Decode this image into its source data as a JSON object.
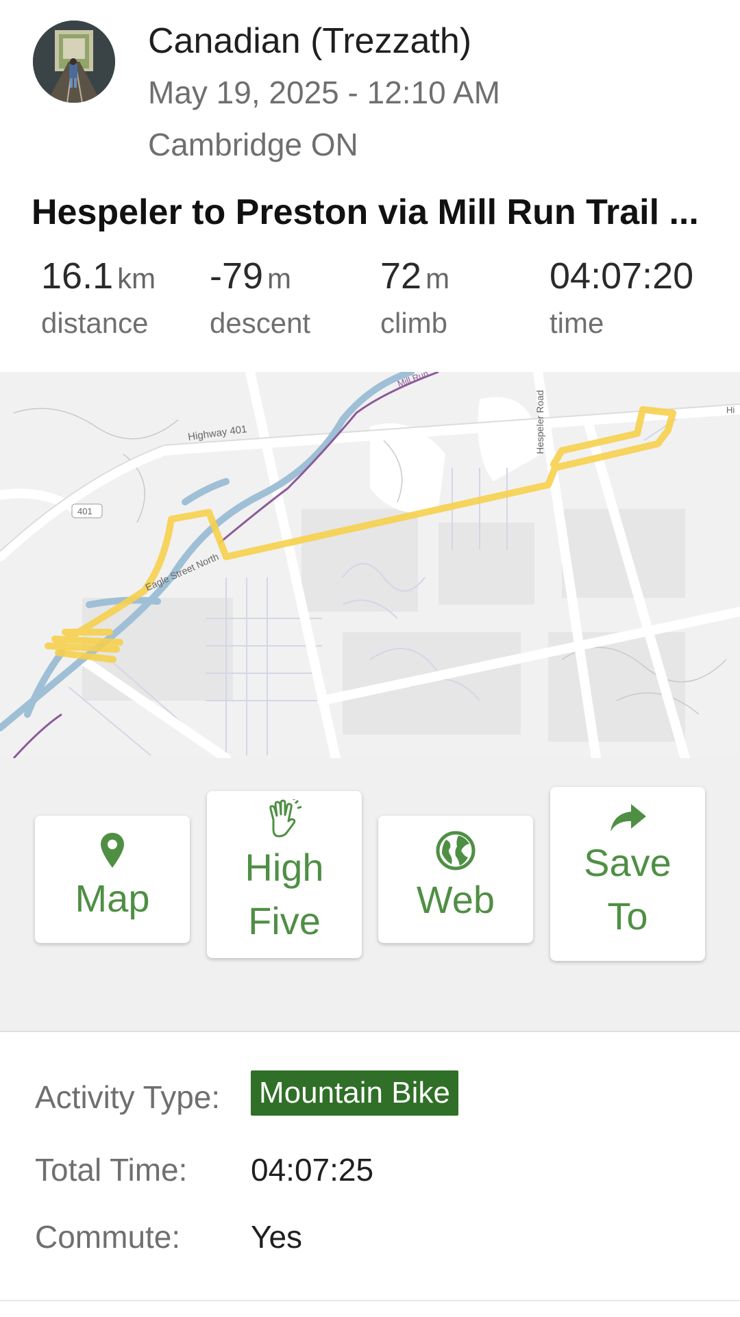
{
  "header": {
    "user_name": "Canadian (Trezzath)",
    "date": "May 19, 2025 - 12:10 AM",
    "location": "Cambridge ON",
    "avatar_icon": "user-photo-railway-tunnel"
  },
  "activity": {
    "title": "Hespeler to Preston via Mill Run Trail ..."
  },
  "stats": [
    {
      "value": "16.1",
      "unit": "km",
      "label": "distance"
    },
    {
      "value": "-79",
      "unit": "m",
      "label": "descent"
    },
    {
      "value": "72",
      "unit": "m",
      "label": "climb"
    },
    {
      "value": "04:07:20",
      "unit": "",
      "label": "time"
    }
  ],
  "map": {
    "labels": {
      "highway": "Highway 401",
      "shield": "401",
      "hespeler_road": "Hespeler Road",
      "eagle_street": "Eagle Street North",
      "mill_run": "Mill Run",
      "edge_hi": "Hi"
    },
    "route_color": "#f6d04d",
    "river_color": "#9fbfd6",
    "trail_color": "#8c5a9a"
  },
  "actions": [
    {
      "icon": "map-pin-icon",
      "label_line1": "Map",
      "label_line2": ""
    },
    {
      "icon": "high-five-icon",
      "label_line1": "High",
      "label_line2": "Five"
    },
    {
      "icon": "globe-icon",
      "label_line1": "Web",
      "label_line2": ""
    },
    {
      "icon": "share-arrow-icon",
      "label_line1": "Save",
      "label_line2": "To"
    }
  ],
  "details": {
    "activity_type_label": "Activity Type:",
    "activity_type_value": "Mountain Bike",
    "total_time_label": "Total Time:",
    "total_time_value": "04:07:25",
    "commute_label": "Commute:",
    "commute_value": "Yes"
  },
  "colors": {
    "accent_green": "#4f8f44",
    "badge_green": "#2f6f27"
  }
}
